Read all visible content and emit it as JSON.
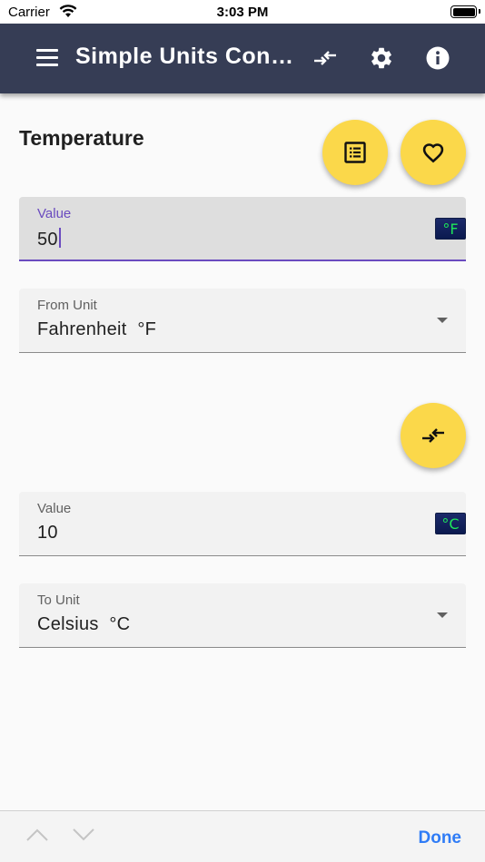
{
  "status_bar": {
    "carrier": "Carrier",
    "time": "3:03 PM"
  },
  "app_bar": {
    "title": "Simple Units Converter"
  },
  "section": {
    "title": "Temperature"
  },
  "input_field": {
    "label": "Value",
    "value": "50",
    "unit_badge": "°F"
  },
  "from_unit": {
    "label": "From Unit",
    "value": "Fahrenheit  °F"
  },
  "output_field": {
    "label": "Value",
    "value": "10",
    "unit_badge": "°C"
  },
  "to_unit": {
    "label": "To Unit",
    "value": "Celsius  °C"
  },
  "keyboard_toolbar": {
    "done_label": "Done"
  },
  "colors": {
    "app_bar": "#363d55",
    "fab": "#fbd84a",
    "focus_accent": "#6a4bbf",
    "badge_text": "#1ee65a",
    "done": "#2f7cf6"
  },
  "icons": {
    "menu": "menu-icon",
    "swap_header": "swap-icon",
    "settings": "gear-icon",
    "info": "info-icon",
    "list": "list-icon",
    "favorite": "heart-icon",
    "swap_fab": "swap-icon",
    "prev": "chevron-up-icon",
    "next": "chevron-down-icon"
  }
}
